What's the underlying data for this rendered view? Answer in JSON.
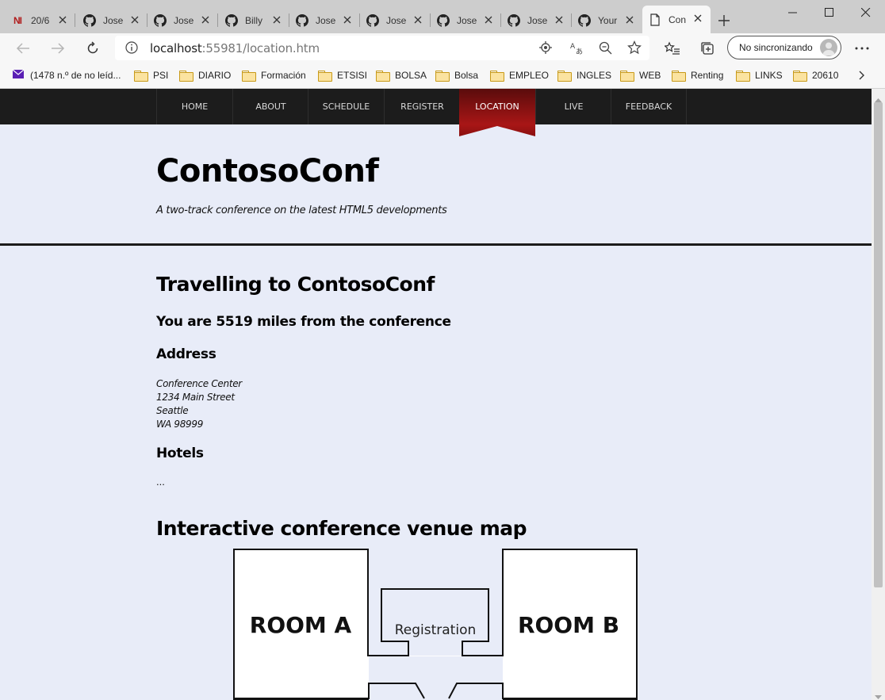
{
  "browser": {
    "tabs": [
      {
        "title": "20/6",
        "icon": "newsletter-icon"
      },
      {
        "title": "Jose",
        "icon": "github-icon"
      },
      {
        "title": "Jose",
        "icon": "github-icon"
      },
      {
        "title": "Billy",
        "icon": "github-icon"
      },
      {
        "title": "Jose",
        "icon": "github-icon"
      },
      {
        "title": "Jose",
        "icon": "github-icon"
      },
      {
        "title": "Jose",
        "icon": "github-icon"
      },
      {
        "title": "Jose",
        "icon": "github-icon"
      },
      {
        "title": "Your",
        "icon": "github-icon"
      },
      {
        "title": "Con",
        "icon": "page-icon",
        "active": true
      }
    ],
    "favicon_text": "NI",
    "url_host": "localhost",
    "url_rest": ":55981/location.htm",
    "sync_label": "No sincronizando",
    "bookmarks": [
      {
        "label": "(1478 n.º de no leíd...",
        "type": "mail"
      },
      {
        "label": "PSI",
        "type": "folder"
      },
      {
        "label": "DIARIO",
        "type": "folder"
      },
      {
        "label": "Formación",
        "type": "folder"
      },
      {
        "label": "ETSISI",
        "type": "folder"
      },
      {
        "label": "BOLSA",
        "type": "folder"
      },
      {
        "label": "Bolsa",
        "type": "folder"
      },
      {
        "label": "EMPLEO",
        "type": "folder"
      },
      {
        "label": "INGLES",
        "type": "folder"
      },
      {
        "label": "WEB",
        "type": "folder"
      },
      {
        "label": "Renting",
        "type": "folder"
      },
      {
        "label": "LINKS",
        "type": "folder"
      },
      {
        "label": "20610",
        "type": "folder"
      }
    ]
  },
  "site": {
    "nav": [
      "HOME",
      "ABOUT",
      "SCHEDULE",
      "REGISTER",
      "LOCATION",
      "LIVE",
      "FEEDBACK"
    ],
    "active_nav": "LOCATION",
    "accent_color": "#a01818",
    "title": "ContosoConf",
    "tagline": "A two-track conference on the latest HTML5 developments"
  },
  "content": {
    "heading": "Travelling to ContosoConf",
    "distance": "You are 5519 miles from the conference",
    "address_heading": "Address",
    "address": [
      "Conference Center",
      "1234 Main Street",
      "Seattle",
      "WA 98999"
    ],
    "hotels_heading": "Hotels",
    "hotels_text": "...",
    "map_heading": "Interactive conference venue map",
    "map": {
      "room_a": "ROOM A",
      "room_b": "ROOM B",
      "registration": "Registration"
    }
  }
}
